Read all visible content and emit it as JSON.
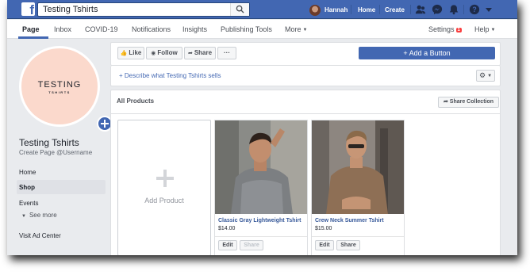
{
  "topbar": {
    "search_value": "Testing Tshirts",
    "user_name": "Hannah",
    "home_label": "Home",
    "create_label": "Create",
    "icons": [
      "friends-icon",
      "messenger-icon",
      "notifications-icon",
      "help-icon",
      "dropdown-icon"
    ]
  },
  "subnav": {
    "tabs": [
      "Page",
      "Inbox",
      "COVID-19",
      "Notifications",
      "Insights",
      "Publishing Tools",
      "More"
    ],
    "settings_label": "Settings",
    "settings_badge": "1",
    "help_label": "Help"
  },
  "profile": {
    "logo_main": "TESTING",
    "logo_sub": "TSHIRTS",
    "page_name": "Testing Tshirts",
    "handle": "Create Page @Username"
  },
  "left_nav": {
    "items": [
      "Home",
      "Shop",
      "Events"
    ],
    "see_more": "See more",
    "ad_center": "Visit Ad Center"
  },
  "actions": {
    "like": "Like",
    "follow": "Follow",
    "share": "Share",
    "more": "···",
    "add_button": "+ Add a Button",
    "describe": "Describe what Testing Tshirts sells"
  },
  "products": {
    "title": "All Products",
    "share_collection": "Share Collection",
    "add_product": "Add Product",
    "items": [
      {
        "name": "Classic Gray Lightweight Tshirt",
        "price": "$14.00",
        "edit": "Edit",
        "share": "Share"
      },
      {
        "name": "Crew Neck Summer Tshirt",
        "price": "$15.00",
        "edit": "Edit",
        "share": "Share"
      }
    ]
  },
  "colors": {
    "brand_blue": "#4267b2",
    "page_bg": "#e9ebee",
    "link_blue": "#365899"
  }
}
